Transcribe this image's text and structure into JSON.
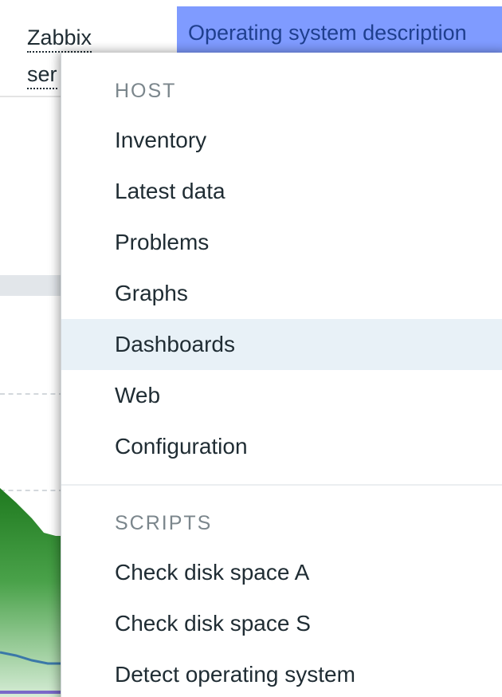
{
  "background": {
    "host_name_line1": "Zabbix",
    "host_name_line2": "ser",
    "column_header": "Operating system description"
  },
  "popup": {
    "host_section": {
      "title": "HOST",
      "items": [
        {
          "label": "Inventory"
        },
        {
          "label": "Latest data"
        },
        {
          "label": "Problems"
        },
        {
          "label": "Graphs"
        },
        {
          "label": "Dashboards",
          "hovered": true
        },
        {
          "label": "Web"
        },
        {
          "label": "Configuration"
        }
      ]
    },
    "scripts_section": {
      "title": "SCRIPTS",
      "items": [
        {
          "label": "Check disk space A"
        },
        {
          "label": "Check disk space S"
        },
        {
          "label": "Detect operating system"
        }
      ]
    }
  },
  "colors": {
    "header_blue": "#7f9bff",
    "hover_row": "#e8f1f7",
    "graph_green": "#2e8b2e",
    "graph_line_blue": "#3b78a8"
  }
}
